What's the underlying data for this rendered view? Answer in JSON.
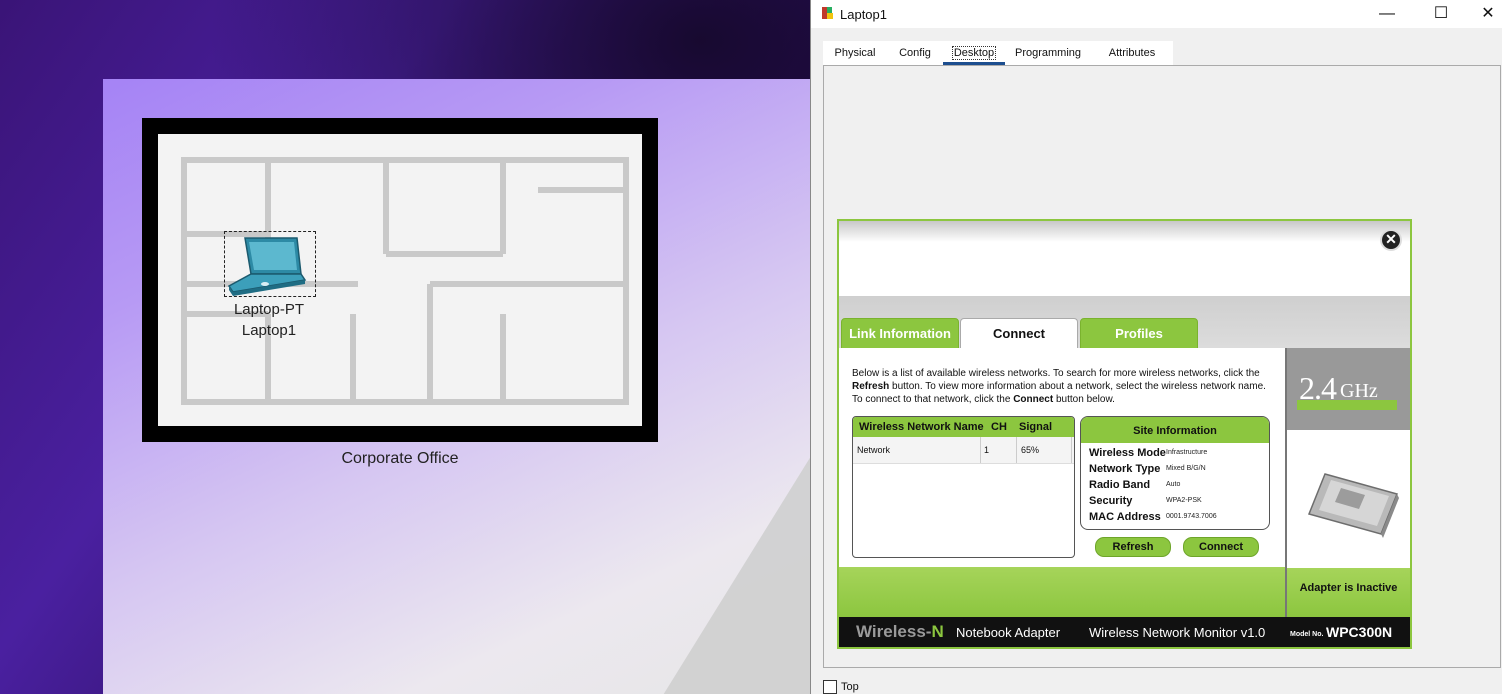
{
  "workspace": {
    "device": {
      "type_label": "Laptop-PT",
      "name_label": "Laptop1"
    },
    "area_label": "Corporate Office"
  },
  "window": {
    "title": "Laptop1",
    "tabs": [
      "Physical",
      "Config",
      "Desktop",
      "Programming",
      "Attributes"
    ],
    "active_tab": "Desktop",
    "top_checkbox_label": "Top",
    "top_checked": false
  },
  "wireless_app": {
    "tabs": [
      "Link Information",
      "Connect",
      "Profiles"
    ],
    "active_tab": "Connect",
    "intro": {
      "p1": "Below is a list of available wireless networks. To search for more wireless networks, click the ",
      "b1": "Refresh",
      "p2": " button. To view more information about a network, select the wireless network name. To connect to that network, click the ",
      "b2": "Connect",
      "p3": " button below."
    },
    "table": {
      "headers": {
        "name": "Wireless Network Name",
        "ch": "CH",
        "signal": "Signal"
      },
      "rows": [
        {
          "name": "Network",
          "ch": "1",
          "signal": "65%"
        }
      ]
    },
    "site_info": {
      "title": "Site Information",
      "rows": [
        {
          "key": "Wireless Mode",
          "value": "Infrastructure"
        },
        {
          "key": "Network Type",
          "value": "Mixed B/G/N"
        },
        {
          "key": "Radio Band",
          "value": "Auto"
        },
        {
          "key": "Security",
          "value": "WPA2-PSK"
        },
        {
          "key": "MAC Address",
          "value": "0001.9743.7006"
        }
      ]
    },
    "buttons": {
      "refresh": "Refresh",
      "connect": "Connect"
    },
    "sidebar": {
      "freq_num": "2.4",
      "freq_unit": "GHz",
      "status": "Adapter is Inactive"
    },
    "footer": {
      "brand": "Wireless-",
      "brand_n": "N",
      "adapter": "Notebook Adapter",
      "monitor": "Wireless Network Monitor  v1.0",
      "model_prefix": "Model No.",
      "model": "WPC300N"
    },
    "colors": {
      "accent_green": "#8cc63f",
      "footer_black": "#111111"
    }
  }
}
